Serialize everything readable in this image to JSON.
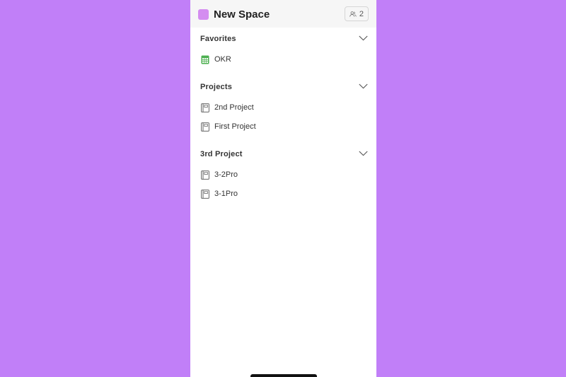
{
  "header": {
    "title": "New Space",
    "swatch_color": "#d48df0",
    "members_count": "2",
    "members_icon": "people-icon"
  },
  "sections": [
    {
      "title": "Favorites",
      "items": [
        {
          "label": "OKR",
          "icon": "spreadsheet-icon"
        }
      ]
    },
    {
      "title": "Projects",
      "items": [
        {
          "label": "2nd Project",
          "icon": "notebook-icon"
        },
        {
          "label": "First Project",
          "icon": "notebook-icon"
        }
      ]
    },
    {
      "title": "3rd Project",
      "items": [
        {
          "label": "3-2Pro",
          "icon": "notebook-icon"
        },
        {
          "label": "3-1Pro",
          "icon": "notebook-icon"
        }
      ]
    }
  ],
  "colors": {
    "background": "#c17ff8",
    "spreadsheet_icon": "#4caf50"
  }
}
